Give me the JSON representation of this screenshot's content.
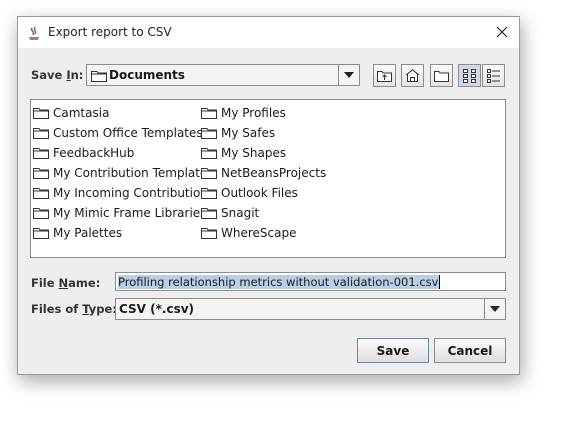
{
  "window": {
    "title": "Export report to CSV",
    "icon": "java-app-icon"
  },
  "save_in": {
    "label_prefix": "Save ",
    "label_mnemonic": "I",
    "label_suffix": "n:",
    "value": "Documents"
  },
  "toolbar": [
    {
      "name": "up-one-level",
      "icon": "folder-up-icon"
    },
    {
      "name": "home",
      "icon": "home-icon"
    },
    {
      "name": "new-folder",
      "icon": "new-folder-icon"
    },
    {
      "name": "list-view",
      "icon": "list-view-icon",
      "pressed": true
    },
    {
      "name": "details-view",
      "icon": "details-view-icon",
      "pressed": false
    }
  ],
  "files": {
    "column1": [
      "Camtasia",
      "Custom Office Templates",
      "FeedbackHub",
      "My Contribution Templates",
      "My Incoming Contributions",
      "My Mimic Frame Libraries",
      "My Palettes"
    ],
    "column2": [
      "My Profiles",
      "My Safes",
      "My Shapes",
      "NetBeansProjects",
      "Outlook Files",
      "Snagit",
      "WhereScape"
    ]
  },
  "file_name": {
    "label_prefix": "File ",
    "label_mnemonic": "N",
    "label_suffix": "ame:",
    "value": "Profiling relationship metrics without validation-001.csv"
  },
  "file_type": {
    "label_prefix": "Files of ",
    "label_mnemonic": "T",
    "label_suffix": "ype:",
    "value": "CSV (*.csv)"
  },
  "buttons": {
    "save": "Save",
    "cancel": "Cancel"
  },
  "colors": {
    "dialog_bg": "#eeeeee",
    "selection": "#b8cfe5"
  }
}
